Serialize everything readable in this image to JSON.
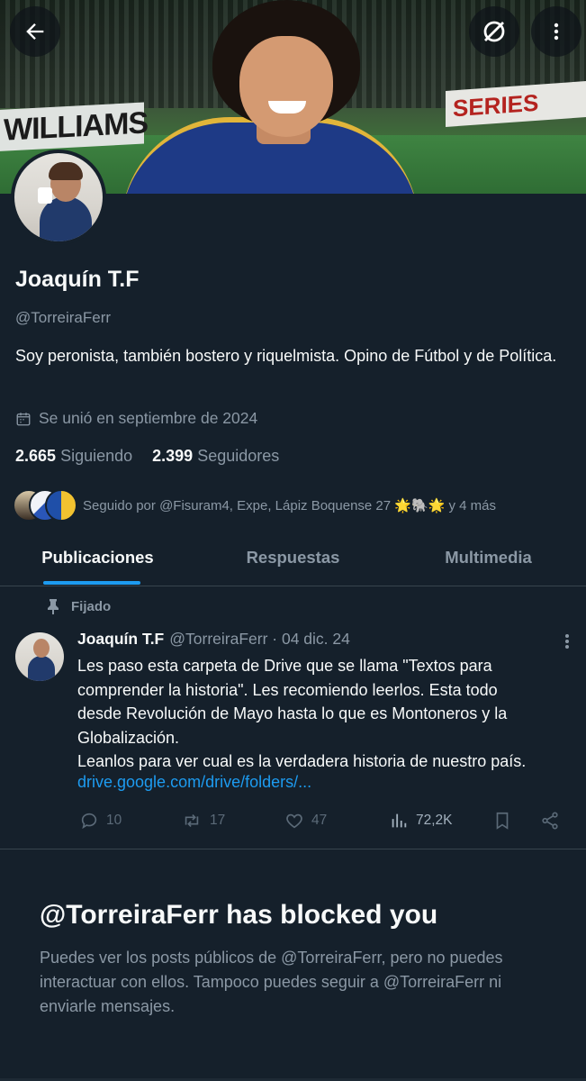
{
  "banner": {
    "board_left": "WILLIAMS",
    "board_right": "SERIES"
  },
  "profile": {
    "name": "Joaquín T.F",
    "handle": "@TorreiraFerr",
    "bio": "Soy peronista, también bostero y riquelmista. Opino de Fútbol y de Política.",
    "joined": "Se unió en septiembre de 2024",
    "following_count": "2.665",
    "following_label": "Siguiendo",
    "followers_count": "2.399",
    "followers_label": "Seguidores",
    "followed_by": "Seguido por @Fisuram4, Expe, Lápiz Boquense 27 🌟🐘🌟 y 4 más"
  },
  "tabs": [
    {
      "label": "Publicaciones",
      "active": true
    },
    {
      "label": "Respuestas",
      "active": false
    },
    {
      "label": "Multimedia",
      "active": false
    }
  ],
  "post": {
    "pinned_label": "Fijado",
    "name": "Joaquín T.F",
    "meta": "@TorreiraFerr · 04 dic. 24",
    "text_lines": [
      "Les paso esta carpeta de Drive que se llama \"Textos para",
      "comprender la historia\". Les recomiendo leerlos. Esta todo",
      "desde Revolución de Mayo hasta lo que es Montoneros y la",
      "Globalización.",
      "Leanlos para ver cual es la verdadera historia de nuestro país."
    ],
    "link": "drive.google.com/drive/folders/...",
    "replies": "10",
    "reposts": "17",
    "likes": "47",
    "views": "72,2K"
  },
  "blocked": {
    "title": "@TorreiraFerr has blocked you",
    "text": "Puedes ver los posts públicos de @TorreiraFerr, pero no puedes interactuar con ellos. Tampoco puedes seguir a @TorreiraFerr ni enviarle mensajes."
  },
  "colors": {
    "background": "#15202b",
    "accent": "#1d9bf0",
    "muted": "#8b98a5",
    "border": "#38444d"
  },
  "icons": [
    "back-arrow-icon",
    "grok-icon",
    "more-vertical-icon",
    "calendar-icon",
    "pin-icon",
    "reply-icon",
    "repost-icon",
    "like-icon",
    "views-icon",
    "bookmark-icon",
    "share-icon"
  ]
}
